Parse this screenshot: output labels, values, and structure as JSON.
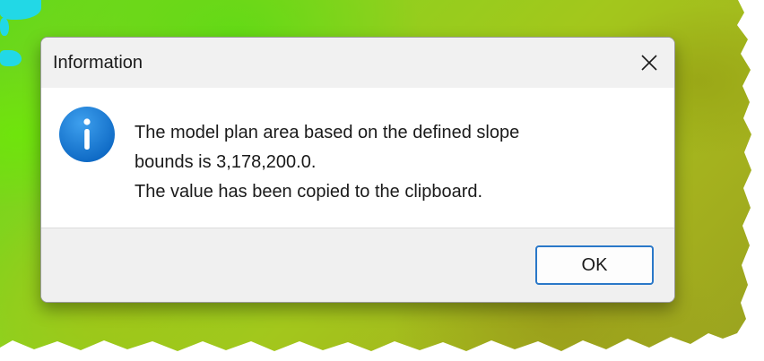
{
  "dialog": {
    "title": "Information",
    "message_lines": [
      "The model plan area based on the defined slope",
      "bounds is 3,178,200.0.",
      "The value has been copied to the clipboard."
    ],
    "ok_label": "OK",
    "icon": "info-icon",
    "close_icon": "close-icon"
  },
  "colors": {
    "accent": "#2a78c8",
    "icon_blue": "#1a7fd4",
    "titlebar": "#f1f1f1",
    "footer": "#f0f0f0",
    "terrain_green": "#63d91a",
    "terrain_olive": "#a4b11e",
    "water": "#22d8e6"
  }
}
